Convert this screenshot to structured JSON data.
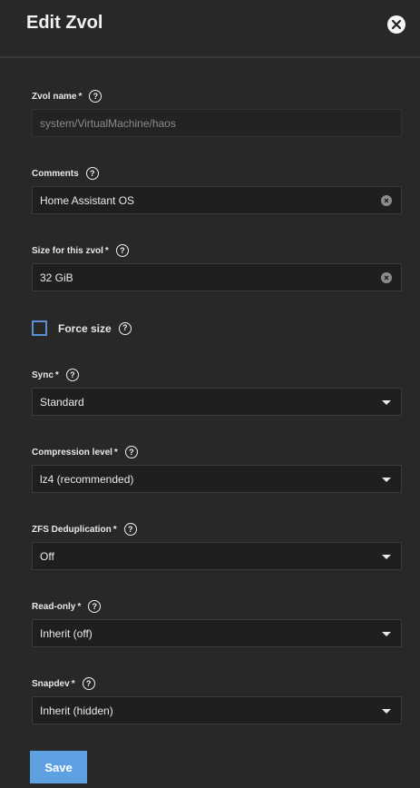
{
  "header": {
    "title": "Edit Zvol",
    "close_icon": "close-icon"
  },
  "fields": {
    "zvol_name": {
      "label": "Zvol name",
      "required": "*",
      "value": "system/VirtualMachine/haos"
    },
    "comments": {
      "label": "Comments",
      "value": "Home Assistant OS"
    },
    "size": {
      "label": "Size for this zvol",
      "required": "*",
      "value": "32 GiB"
    },
    "force_size": {
      "label": "Force size",
      "checked": false
    },
    "sync": {
      "label": "Sync",
      "required": "*",
      "value": "Standard"
    },
    "compression": {
      "label": "Compression level",
      "required": "*",
      "value": "lz4 (recommended)"
    },
    "dedup": {
      "label": "ZFS Deduplication",
      "required": "*",
      "value": "Off"
    },
    "readonly": {
      "label": "Read-only",
      "required": "*",
      "value": "Inherit (off)"
    },
    "snapdev": {
      "label": "Snapdev",
      "required": "*",
      "value": "Inherit (hidden)"
    }
  },
  "actions": {
    "save_label": "Save"
  },
  "help_glyph": "?",
  "colors": {
    "background": "#282828",
    "input": "#1f1f1f",
    "accent": "#5ea1e3",
    "checkbox": "#5b8fd1"
  }
}
